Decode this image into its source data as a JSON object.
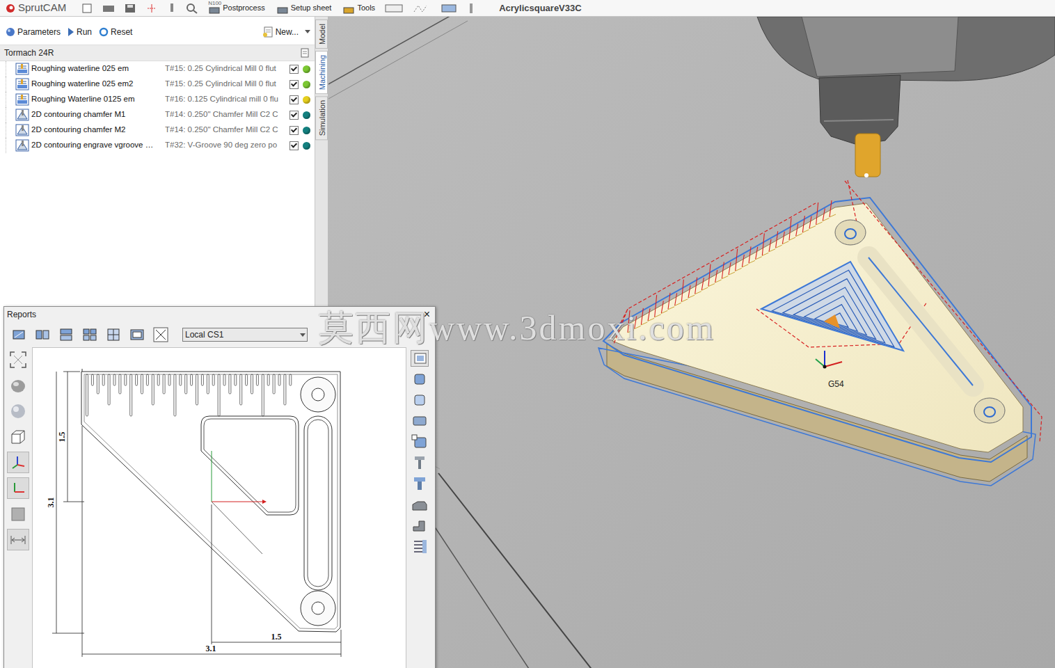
{
  "app": {
    "logo": "SprutCAM",
    "file_title": "AcrylicsquareV33C"
  },
  "main_toolbar": [
    {
      "label": "Postprocess",
      "badge": "N100"
    },
    {
      "label": "Setup sheet"
    },
    {
      "label": "Tools"
    }
  ],
  "ops_toolbar": {
    "parameters": "Parameters",
    "run": "Run",
    "reset": "Reset",
    "new": "New..."
  },
  "machine": "Tormach 24R",
  "operations": [
    {
      "name": "Roughing waterline 025 em",
      "tool": "T#15: 0.25 Cylindrical Mill 0 flut",
      "kind": "roughing",
      "checked": true,
      "color": "#7cc832"
    },
    {
      "name": "Roughing waterline 025 em2",
      "tool": "T#15: 0.25 Cylindrical Mill 0 flut",
      "kind": "roughing",
      "checked": true,
      "color": "#7cc832"
    },
    {
      "name": "Roughing Waterline 0125 em",
      "tool": "T#16: 0.125 Cylindrical mill 0 flu",
      "kind": "roughing",
      "checked": true,
      "color": "#e6cf1e"
    },
    {
      "name": "2D contouring chamfer M1",
      "tool": "T#14: 0.250\" Chamfer Mill C2 C",
      "kind": "contouring",
      "checked": true,
      "color": "#13807f"
    },
    {
      "name": "2D contouring chamfer M2",
      "tool": "T#14: 0.250\" Chamfer Mill C2 C",
      "kind": "contouring",
      "checked": true,
      "color": "#13807f"
    },
    {
      "name": "2D contouring engrave vgroove …",
      "tool": "T#32: V-Groove 90 deg zero po",
      "kind": "contouring",
      "checked": true,
      "color": "#13807f"
    }
  ],
  "side_tabs": [
    {
      "label": "Model",
      "selected": false
    },
    {
      "label": "Machining",
      "selected": true
    },
    {
      "label": "Simulation",
      "selected": false
    }
  ],
  "viewport": {
    "cs_label": "G54"
  },
  "watermark": "莫西网www.3dmoxi.com",
  "reports": {
    "title": "Reports",
    "close": "×",
    "coordinate_system": "Local CS1",
    "dimensions": [
      {
        "value": "1.5",
        "kind": "vertical"
      },
      {
        "value": "3.1",
        "kind": "vertical"
      },
      {
        "value": "1.5",
        "kind": "horizontal"
      },
      {
        "value": "3.1",
        "kind": "horizontal"
      }
    ]
  }
}
